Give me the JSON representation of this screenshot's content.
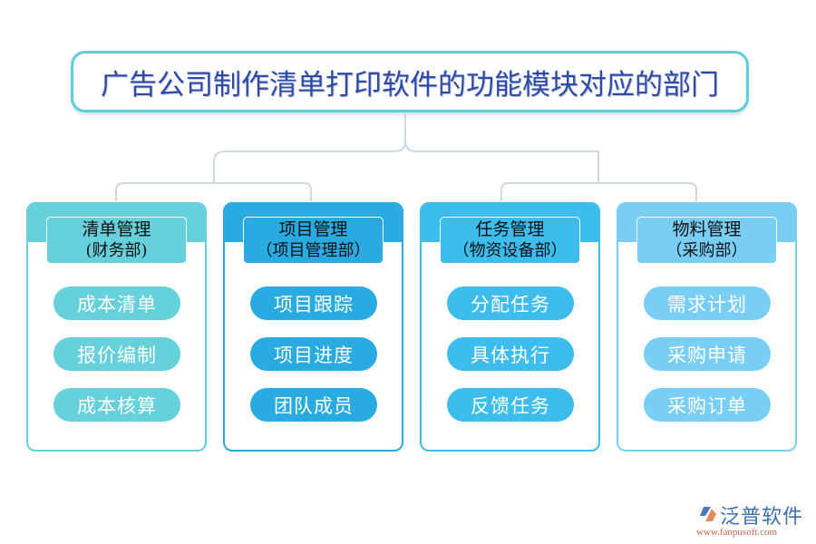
{
  "title": "广告公司制作清单打印软件的功能模块对应的部门",
  "modules": [
    {
      "name": "清单管理",
      "department": "(财务部)",
      "color": "#66d1db",
      "items": [
        "成本清单",
        "报价编制",
        "成本核算"
      ]
    },
    {
      "name": "项目管理",
      "department": "（项目管理部）",
      "color": "#29abe2",
      "items": [
        "项目跟踪",
        "项目进度",
        "团队成员"
      ]
    },
    {
      "name": "任务管理",
      "department": "（物资设备部）",
      "color": "#3dbcee",
      "items": [
        "分配任务",
        "具体执行",
        "反馈任务"
      ]
    },
    {
      "name": "物料管理",
      "department": "（采购部）",
      "color": "#78cef4",
      "items": [
        "需求计划",
        "采购申请",
        "采购订单"
      ]
    }
  ],
  "connector_color": "#cfd9e6",
  "logo": {
    "icon": "fanpu-logo-icon",
    "name": "泛普软件",
    "url": "www.fanpusoft.com"
  }
}
